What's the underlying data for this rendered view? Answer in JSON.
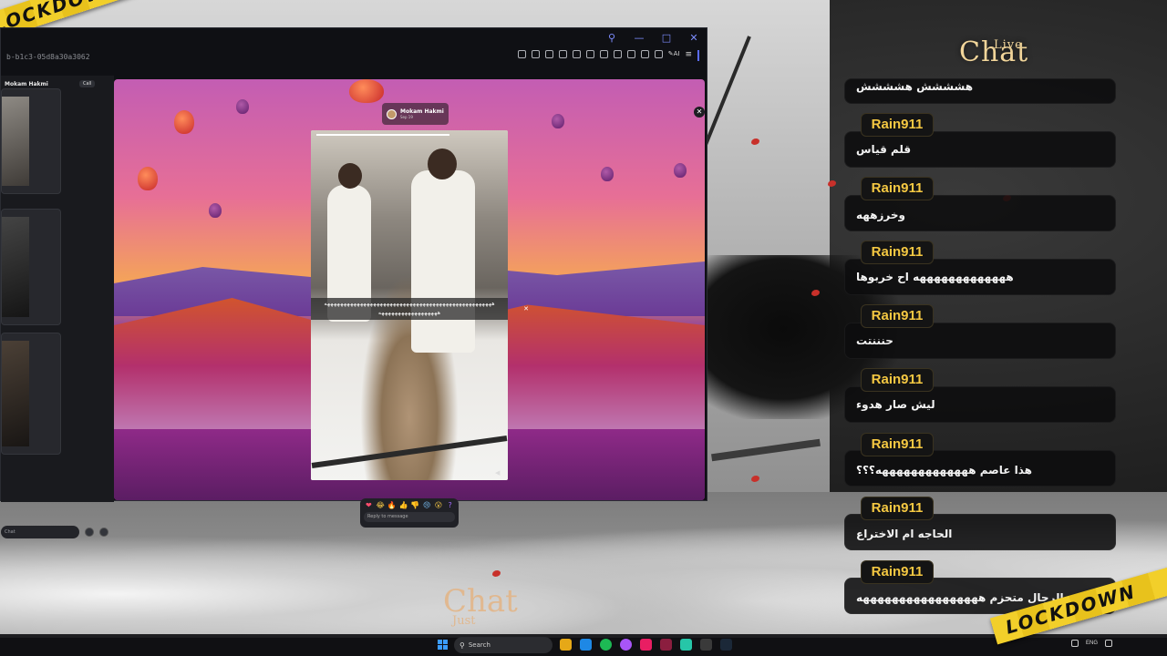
{
  "taskbar": {
    "search_placeholder": "Search",
    "tray_language": "ENG"
  },
  "tapes": {
    "top_left": "LOCKDOWN",
    "bottom_right": "LOCKDOWN"
  },
  "messenger": {
    "conversation_id": "b-b1c3-05d8a30a3062",
    "left_header": "Mokam Hakmi",
    "call_label": "Call",
    "chat_placeholder": "Chat",
    "story": {
      "poster_name": "Mokam Hakmi",
      "poster_time": "Sep 19",
      "caption_line1": "هههههههههههههههههههههههههههههههههههههههههههههههههههه",
      "caption_line2": "ههههههههههههههههههه",
      "reactions": [
        "❤",
        "😂",
        "🔥",
        "👍",
        "👎",
        "😢",
        "😮",
        "?"
      ],
      "reply_placeholder": "Reply to message"
    }
  },
  "live_chat": {
    "logo_title": "Chat",
    "logo_badge": "Live",
    "bottom_logo": "Chat",
    "bottom_logo_sub": "Just",
    "messages": [
      {
        "user": "",
        "text": "هشششش هشششش"
      },
      {
        "user": "Rain911",
        "text": "قلم قياس"
      },
      {
        "user": "Rain911",
        "text": "وخرزههه"
      },
      {
        "user": "Rain911",
        "text": "هههههههههههههه اح خربوها"
      },
      {
        "user": "Rain911",
        "text": "حنننتت"
      },
      {
        "user": "Rain911",
        "text": "ليش صار هدوء"
      },
      {
        "user": "Rain911",
        "text": "هذا عاصم هههههههههههههه؟؟؟"
      },
      {
        "user": "Rain911",
        "text": "الحاجه ام الاختراع"
      },
      {
        "user": "Rain911",
        "text": "الرجال متحزم هههههههههههههههههه"
      }
    ]
  },
  "colors": {
    "chat_username": "#f5c842",
    "chat_bubble": "#0c0c0e",
    "tape_yellow": "#f2cf2a",
    "accent_blue": "#5b6cff"
  }
}
